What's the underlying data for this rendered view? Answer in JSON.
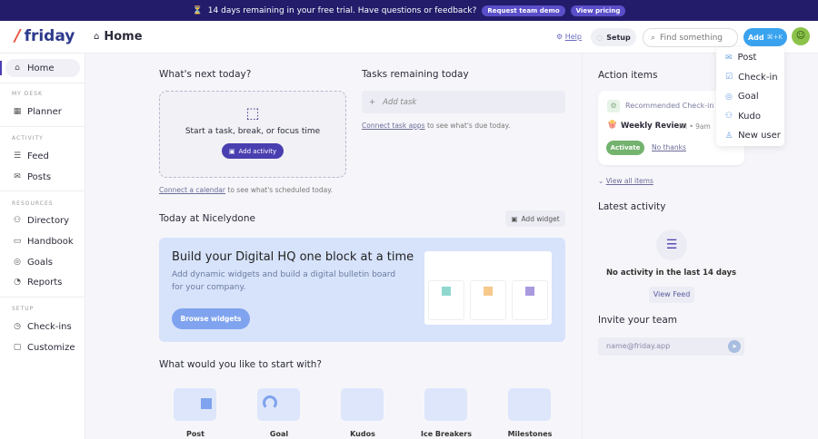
{
  "banner": {
    "text": "14 days remaining in your free trial. Have questions or feedback?",
    "demo": "Request team demo",
    "pricing": "View pricing"
  },
  "header": {
    "logo": "friday",
    "title": "Home",
    "help": "Help",
    "setup": "Setup",
    "search_placeholder": "Find something",
    "add": "Add",
    "shortcut": "⌘+K"
  },
  "sidebar": {
    "home": "Home",
    "my_desk": "MY DESK",
    "planner": "Planner",
    "activity": "ACTIVITY",
    "feed": "Feed",
    "posts": "Posts",
    "resources": "RESOURCES",
    "directory": "Directory",
    "handbook": "Handbook",
    "goals": "Goals",
    "reports": "Reports",
    "setup": "SETUP",
    "checkins": "Check-ins",
    "customize": "Customize"
  },
  "whats_next": {
    "title": "What's next today?",
    "prompt": "Start a task, break, or focus time",
    "button": "Add activity",
    "connect_link": "Connect a calendar",
    "connect_rest": "to see what's scheduled today."
  },
  "tasks": {
    "title": "Tasks remaining today",
    "add_placeholder": "Add task",
    "connect_link": "Connect task apps",
    "connect_rest": "to see what's due today."
  },
  "today": {
    "title": "Today at Nicelydone",
    "add_widget": "Add widget"
  },
  "promo": {
    "title": "Build your Digital HQ one block at a time",
    "desc": "Add dynamic widgets and build a digital bulletin board for your company.",
    "button": "Browse widgets"
  },
  "start": {
    "title": "What would you like to start with?",
    "items": [
      "Post",
      "Goal",
      "Kudos",
      "Ice Breakers",
      "Milestones"
    ]
  },
  "action_items": {
    "title": "Action items",
    "recommended": "Recommended Check-in",
    "name": "Weekly Review",
    "when": "Fri • 9am",
    "activate": "Activate",
    "no_thanks": "No thanks",
    "view_all": "View all items"
  },
  "latest": {
    "title": "Latest activity",
    "empty": "No activity in the last 14 days",
    "view_feed": "View Feed"
  },
  "invite": {
    "title": "Invite your team",
    "placeholder": "name@friday.app"
  },
  "add_menu": [
    "Post",
    "Check-in",
    "Goal",
    "Kudo",
    "New user"
  ]
}
